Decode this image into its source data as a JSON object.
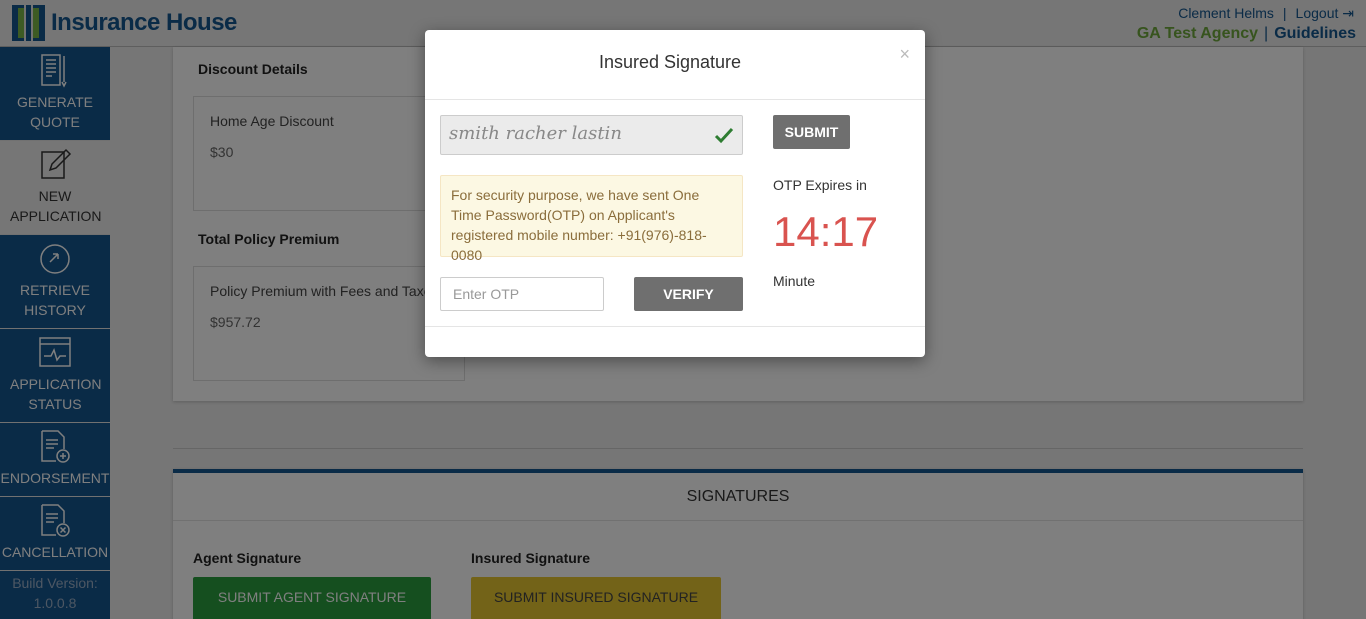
{
  "header": {
    "logo_text": "Insurance House",
    "user_name": "Clement Helms",
    "logout_label": "Logout",
    "agency_name": "GA Test Agency",
    "guidelines_label": "Guidelines"
  },
  "sidebar": {
    "items": [
      {
        "label": "GENERATE QUOTE",
        "icon": "generate-quote-icon"
      },
      {
        "label": "NEW APPLICATION",
        "icon": "new-application-icon"
      },
      {
        "label": "RETRIEVE HISTORY",
        "icon": "retrieve-history-icon"
      },
      {
        "label": "APPLICATION STATUS",
        "icon": "application-status-icon"
      },
      {
        "label": "ENDORSEMENT",
        "icon": "endorsement-icon"
      },
      {
        "label": "CANCELLATION",
        "icon": "cancellation-icon"
      }
    ],
    "build_label": "Build Version:",
    "build_version": "1.0.0.8"
  },
  "main": {
    "discount": {
      "title": "Discount Details",
      "label": "Home Age Discount",
      "value": "$30"
    },
    "premium": {
      "title": "Total Policy Premium",
      "label": "Policy Premium with Fees and Taxes",
      "value": "$957.72"
    },
    "signatures": {
      "title": "SIGNATURES",
      "agent_label": "Agent Signature",
      "agent_button": "SUBMIT AGENT SIGNATURE",
      "insured_label": "Insured Signature",
      "insured_button": "SUBMIT INSURED SIGNATURE"
    }
  },
  "modal": {
    "title": "Insured Signature",
    "close": "×",
    "signature_text": "smith racher lastin",
    "submit_label": "SUBMIT",
    "notice": "For security purpose, we have sent One Time Password(OTP) on Applicant's registered mobile number: +91(976)-818-0080",
    "otp_expires_label": "OTP Expires in",
    "timer": "14:17",
    "timer_unit": "Minute",
    "otp_placeholder": "Enter OTP",
    "verify_label": "VERIFY"
  },
  "colors": {
    "brand_blue": "#14568f",
    "brand_green": "#6fa83d",
    "timer_red": "#d9534f",
    "agent_button": "#2a9e3f",
    "insured_button": "#e6c730"
  }
}
